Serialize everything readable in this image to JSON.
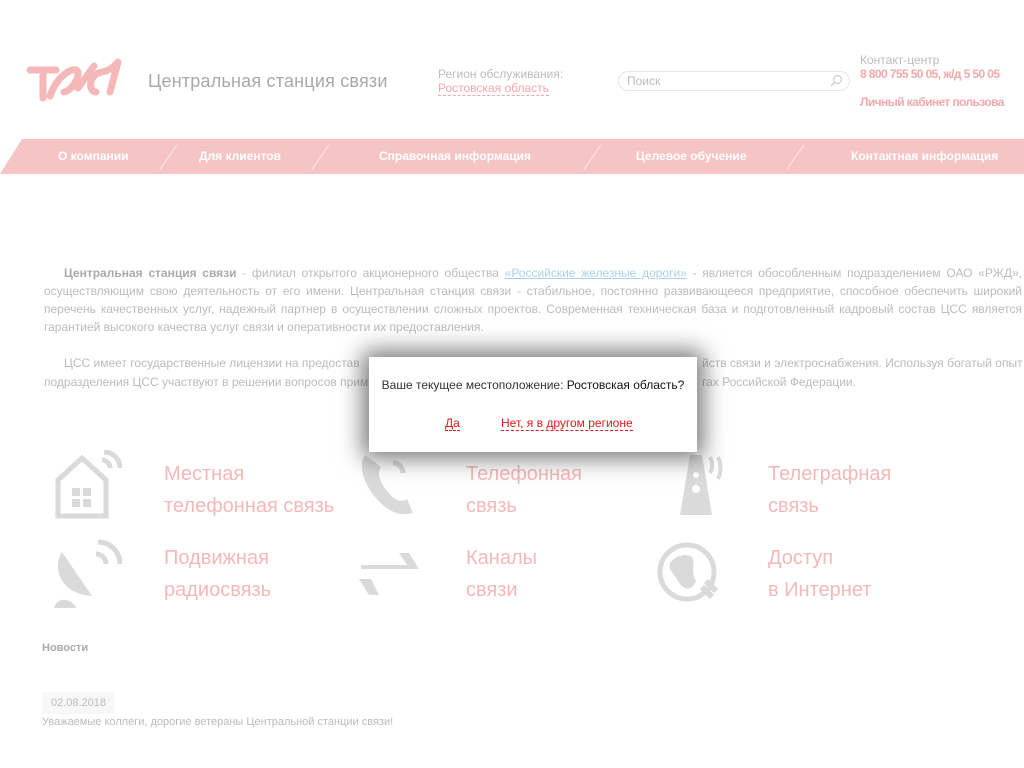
{
  "header": {
    "logo_text": "РЖД",
    "site_title": "Центральная станция связи",
    "region_label": "Регион обслуживания:",
    "region_value": "Ростовская область",
    "search_placeholder": "Поиск",
    "contact_label": "Контакт-центр",
    "contact_phone": "8 800 755 50 05, ж/д 5 50 05",
    "cabinet_link": "Личный кабинет пользова"
  },
  "nav": {
    "items": [
      {
        "label": "О компании"
      },
      {
        "label": "Для клиентов"
      },
      {
        "label": "Справочная информация"
      },
      {
        "label": "Целевое обучение"
      },
      {
        "label": "Контактная информация"
      }
    ]
  },
  "intro": {
    "p1_bold": "Центральная станция связи",
    "p1_a": " - филиал открытого акционерного общества ",
    "p1_link": "«Российские железные дороги»",
    "p1_b": " - является обособленным подразделением ОАО «РЖД», осуществляющим свою деятельность от его имени. Центральная станция связи - стабильное, постоянно развивающееся предприятие, способное обеспечить широкий перечень качественных услуг, надежный партнер в осуществлении сложных проектов. Современная техническая база и подготовленный кадровый состав ЦСС является гарантией высокого качества услуг связи и оперативности их предоставления.",
    "p2_line1_left": "ЦСС имеет государственные лицензии на предостав",
    "p2_line1_right": "йств связи и электроснабжения. Используя богатый опыт",
    "p2_line2_left": "подразделения ЦСС участвуют в решении вопросов прим",
    "p2_line2_right": "гах Российской Федерации."
  },
  "services": [
    {
      "line1": "Местная",
      "line2": "телефонная связь",
      "icon": "house-signal-icon"
    },
    {
      "line1": "Телефонная",
      "line2": "связь",
      "icon": "phone-handset-icon"
    },
    {
      "line1": "Телеграфная",
      "line2": "связь",
      "icon": "radio-tower-icon"
    },
    {
      "line1": "Подвижная",
      "line2": "радиосвязь",
      "icon": "satellite-dish-icon"
    },
    {
      "line1": "Каналы",
      "line2": "связи",
      "icon": "exchange-arrows-icon"
    },
    {
      "line1": "Доступ",
      "line2": "в Интернет",
      "icon": "globe-plug-icon"
    }
  ],
  "news": {
    "heading": "Новости",
    "items": [
      {
        "date": "02.08.2018",
        "title": "Уважаемые коллеги, дорогие ветераны Центральной станции связи!"
      }
    ]
  },
  "modal": {
    "question": "Ваше текущее местоположение: ",
    "region": "Ростовская область?",
    "yes": "Да",
    "no": "Нет, я в другом регионе"
  },
  "colors": {
    "brand_red": "#e21a1a",
    "link_blue": "#1a7fc1"
  }
}
